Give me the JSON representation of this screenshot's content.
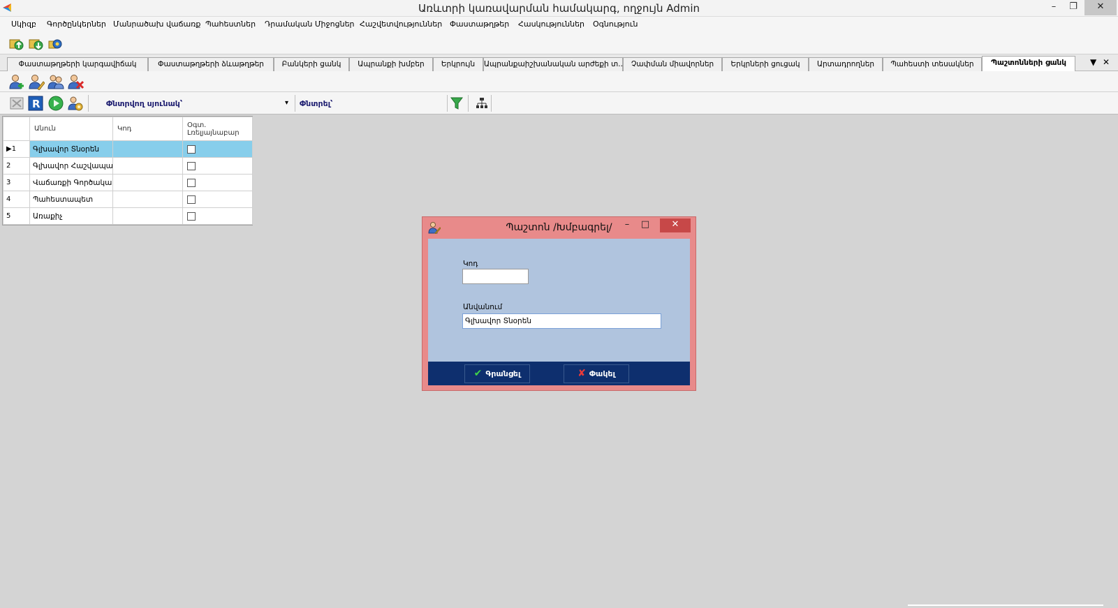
{
  "window": {
    "title": "Առևտրի կառավարման համակարգ, ողջույն Admin",
    "minimize": "–",
    "restore": "❐",
    "close": "✕"
  },
  "menu": [
    "Սկիզբ",
    "Գործընկերներ",
    "Մանրածախ վաճառք",
    "Պահեստներ",
    "Դրամական Միջոցներ",
    "Հաշվետվություններ",
    "Փաստաթղթեր",
    "Հասկություններ",
    "Օգնություն"
  ],
  "tabs": [
    "Փաստաթղթերի կարգավիճակ",
    "Փաստաթղթերի ձևաթղթեր",
    "Բանկերի ցանկ",
    "Ապրանքի խմբեր",
    "Երկրույն",
    "Ապրանքաիշխանական արժեքի տ...",
    "Չափման միավորներ",
    "Երկրների ցուցակ",
    "Արտադրողներ",
    "Պահեստի տեսակներ",
    "Պաշտոնների ցանկ"
  ],
  "tab_controls": {
    "dropdown": "▼",
    "close": "✕"
  },
  "filter": {
    "column_label": "Փնտրվող սյունակ՝",
    "search_label": "Փնտրել՝",
    "column_value": "",
    "search_value": "",
    "dropdown_arrow": "▾"
  },
  "grid": {
    "columns": [
      "Անուն",
      "Կոդ",
      "Օգտ. Լռելյայնաբար"
    ],
    "rows": [
      {
        "num": "1",
        "name": "Գլխավոր Տնօրեն",
        "code": "",
        "checked": false,
        "selected": true
      },
      {
        "num": "2",
        "name": "Գլխավոր Հաշվապահ",
        "code": "",
        "checked": false,
        "selected": false
      },
      {
        "num": "3",
        "name": "Վաճառքի Գործակալ",
        "code": "",
        "checked": false,
        "selected": false
      },
      {
        "num": "4",
        "name": "Պահեստապետ",
        "code": "",
        "checked": false,
        "selected": false
      },
      {
        "num": "5",
        "name": "Առաքիչ",
        "code": "",
        "checked": false,
        "selected": false
      }
    ],
    "selection_marker": "▶"
  },
  "dialog": {
    "title": "Պաշտոն /Խմբագրել/",
    "minimize": "–",
    "maximize": "□",
    "close": "✕",
    "code_label": "Կոդ",
    "code_value": "",
    "name_label": "Անվանում",
    "name_value": "Գլխավոր Տնօրեն",
    "save_label": "Գրանցել",
    "cancel_label": "Փակել",
    "save_mark": "✔",
    "cancel_mark": "✘"
  },
  "colors": {
    "selected_row": "#87ceeb",
    "dialog_frame": "#e88a8a",
    "dialog_body": "#b0c4de",
    "dialog_footer": "#0e2f6e"
  }
}
